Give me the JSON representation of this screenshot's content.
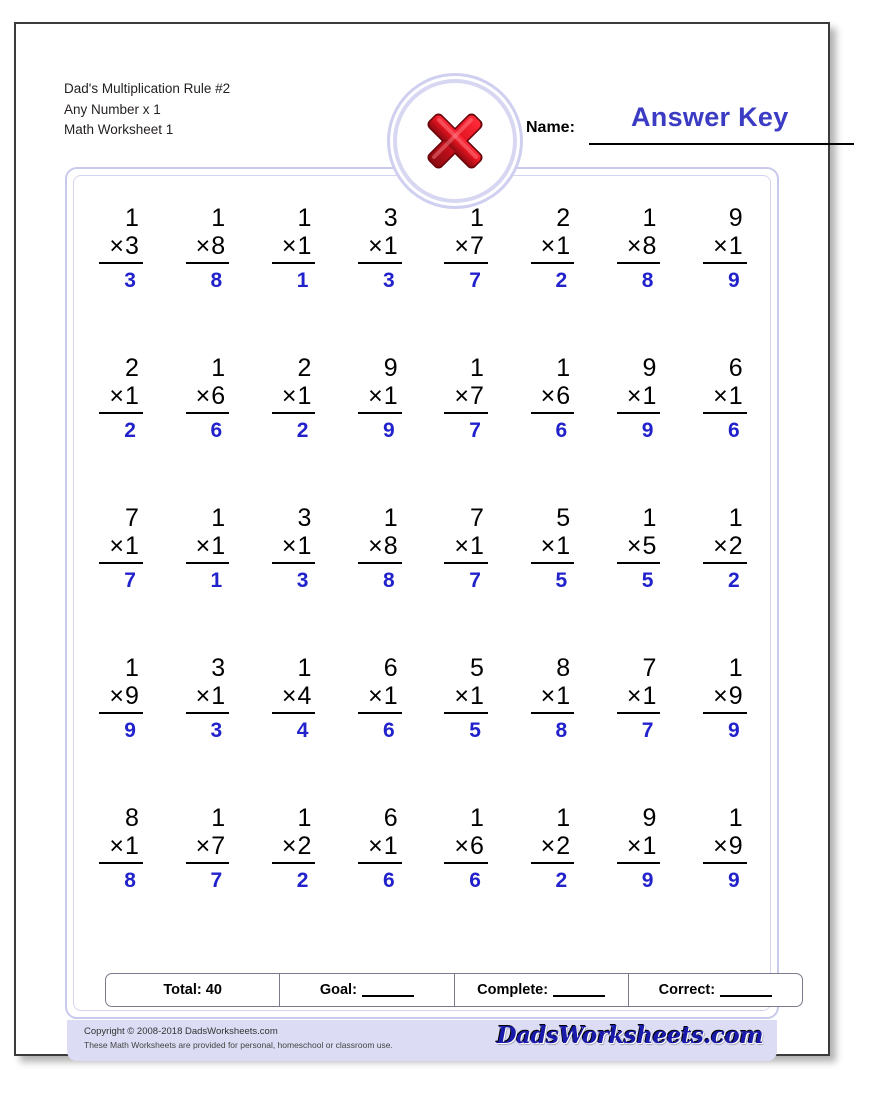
{
  "header": {
    "title_lines": "Dad's Multiplication Rule #2\nAny Number x 1\nMath Worksheet 1",
    "name_label": "Name:",
    "answer_key_text": "Answer Key",
    "badge_icon": "red-x-icon"
  },
  "colors": {
    "answer_blue": "#2222cc",
    "answer_key_blue": "#3b3bc4",
    "frame_lavender": "#c9c9ec",
    "footer_band": "#dcdcf5",
    "x_red": "#e01b24",
    "page_border": "#3b3b3b"
  },
  "problems": [
    {
      "top": "1",
      "bottom": "3",
      "sign": "×",
      "answer": "3"
    },
    {
      "top": "1",
      "bottom": "8",
      "sign": "×",
      "answer": "8"
    },
    {
      "top": "1",
      "bottom": "1",
      "sign": "×",
      "answer": "1"
    },
    {
      "top": "3",
      "bottom": "1",
      "sign": "×",
      "answer": "3"
    },
    {
      "top": "1",
      "bottom": "7",
      "sign": "×",
      "answer": "7"
    },
    {
      "top": "2",
      "bottom": "1",
      "sign": "×",
      "answer": "2"
    },
    {
      "top": "1",
      "bottom": "8",
      "sign": "×",
      "answer": "8"
    },
    {
      "top": "9",
      "bottom": "1",
      "sign": "×",
      "answer": "9"
    },
    {
      "top": "2",
      "bottom": "1",
      "sign": "×",
      "answer": "2"
    },
    {
      "top": "1",
      "bottom": "6",
      "sign": "×",
      "answer": "6"
    },
    {
      "top": "2",
      "bottom": "1",
      "sign": "×",
      "answer": "2"
    },
    {
      "top": "9",
      "bottom": "1",
      "sign": "×",
      "answer": "9"
    },
    {
      "top": "1",
      "bottom": "7",
      "sign": "×",
      "answer": "7"
    },
    {
      "top": "1",
      "bottom": "6",
      "sign": "×",
      "answer": "6"
    },
    {
      "top": "9",
      "bottom": "1",
      "sign": "×",
      "answer": "9"
    },
    {
      "top": "6",
      "bottom": "1",
      "sign": "×",
      "answer": "6"
    },
    {
      "top": "7",
      "bottom": "1",
      "sign": "×",
      "answer": "7"
    },
    {
      "top": "1",
      "bottom": "1",
      "sign": "×",
      "answer": "1"
    },
    {
      "top": "3",
      "bottom": "1",
      "sign": "×",
      "answer": "3"
    },
    {
      "top": "1",
      "bottom": "8",
      "sign": "×",
      "answer": "8"
    },
    {
      "top": "7",
      "bottom": "1",
      "sign": "×",
      "answer": "7"
    },
    {
      "top": "5",
      "bottom": "1",
      "sign": "×",
      "answer": "5"
    },
    {
      "top": "1",
      "bottom": "5",
      "sign": "×",
      "answer": "5"
    },
    {
      "top": "1",
      "bottom": "2",
      "sign": "×",
      "answer": "2"
    },
    {
      "top": "1",
      "bottom": "9",
      "sign": "×",
      "answer": "9"
    },
    {
      "top": "3",
      "bottom": "1",
      "sign": "×",
      "answer": "3"
    },
    {
      "top": "1",
      "bottom": "4",
      "sign": "×",
      "answer": "4"
    },
    {
      "top": "6",
      "bottom": "1",
      "sign": "×",
      "answer": "6"
    },
    {
      "top": "5",
      "bottom": "1",
      "sign": "×",
      "answer": "5"
    },
    {
      "top": "8",
      "bottom": "1",
      "sign": "×",
      "answer": "8"
    },
    {
      "top": "7",
      "bottom": "1",
      "sign": "×",
      "answer": "7"
    },
    {
      "top": "1",
      "bottom": "9",
      "sign": "×",
      "answer": "9"
    },
    {
      "top": "8",
      "bottom": "1",
      "sign": "×",
      "answer": "8"
    },
    {
      "top": "1",
      "bottom": "7",
      "sign": "×",
      "answer": "7"
    },
    {
      "top": "1",
      "bottom": "2",
      "sign": "×",
      "answer": "2"
    },
    {
      "top": "6",
      "bottom": "1",
      "sign": "×",
      "answer": "6"
    },
    {
      "top": "1",
      "bottom": "6",
      "sign": "×",
      "answer": "6"
    },
    {
      "top": "1",
      "bottom": "2",
      "sign": "×",
      "answer": "2"
    },
    {
      "top": "9",
      "bottom": "1",
      "sign": "×",
      "answer": "9"
    },
    {
      "top": "1",
      "bottom": "9",
      "sign": "×",
      "answer": "9"
    }
  ],
  "scorebar": {
    "total": "Total: 40",
    "goal": "Goal:",
    "complete": "Complete:",
    "correct": "Correct:"
  },
  "footer": {
    "copyright": "Copyright © 2008-2018 DadsWorksheets.com",
    "usage": "These Math Worksheets are provided for personal, homeschool or classroom use.",
    "brand": "DadsWorksheets.com"
  }
}
